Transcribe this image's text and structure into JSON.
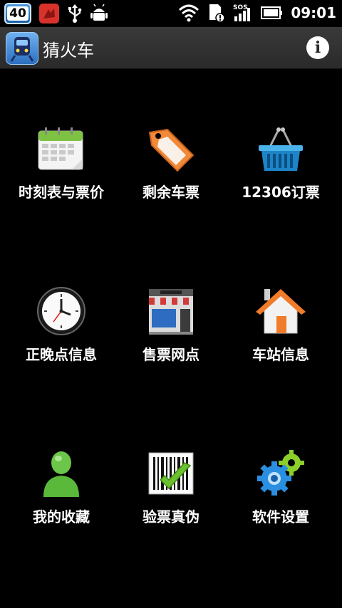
{
  "status_bar": {
    "notification_count": "40",
    "time": "09:01",
    "icons": [
      "badge-icon",
      "app-notification-icon",
      "usb-icon",
      "android-debug-icon",
      "wifi-icon",
      "sd-card-alert-icon",
      "signal-sos-icon",
      "battery-icon"
    ]
  },
  "header": {
    "title": "猜火车"
  },
  "menu": {
    "items": [
      {
        "label": "时刻表与票价",
        "icon": "calendar-icon"
      },
      {
        "label": "剩余车票",
        "icon": "tag-icon"
      },
      {
        "label": "12306订票",
        "icon": "basket-icon"
      },
      {
        "label": "正晚点信息",
        "icon": "clock-icon"
      },
      {
        "label": "售票网点",
        "icon": "shop-icon"
      },
      {
        "label": "车站信息",
        "icon": "house-icon"
      },
      {
        "label": "我的收藏",
        "icon": "user-icon"
      },
      {
        "label": "验票真伪",
        "icon": "barcode-check-icon"
      },
      {
        "label": "软件设置",
        "icon": "gears-icon"
      }
    ]
  },
  "colors": {
    "background": "#000000",
    "titlebar": "#2f2f2f",
    "accent": "#3d8de0"
  }
}
